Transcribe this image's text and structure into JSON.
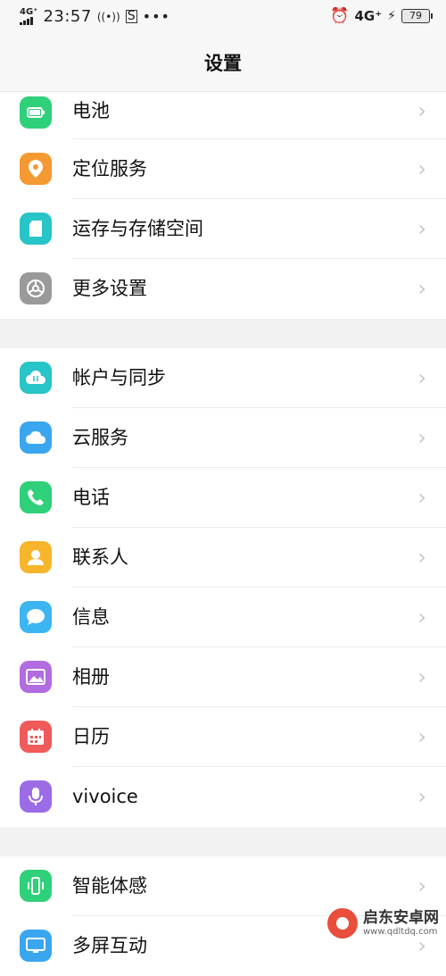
{
  "status_bar": {
    "network_left": "4G⁺",
    "time": "23:57",
    "network_right": "4G⁺",
    "battery": "79"
  },
  "header": {
    "title": "设置"
  },
  "groups": [
    {
      "items": [
        {
          "label": "电池",
          "icon": "battery-icon",
          "color": "#2fd07a"
        },
        {
          "label": "定位服务",
          "icon": "location-icon",
          "color": "#f59a32"
        },
        {
          "label": "运存与存储空间",
          "icon": "storage-icon",
          "color": "#27c4c8"
        },
        {
          "label": "更多设置",
          "icon": "gear-icon",
          "color": "#9a9a9a"
        }
      ]
    },
    {
      "items": [
        {
          "label": "帐户与同步",
          "icon": "cloud-sync-icon",
          "color": "#27c4c8"
        },
        {
          "label": "云服务",
          "icon": "cloud-icon",
          "color": "#3aa6f0"
        },
        {
          "label": "电话",
          "icon": "phone-icon",
          "color": "#2fd07a"
        },
        {
          "label": "联系人",
          "icon": "contact-icon",
          "color": "#f7b52b"
        },
        {
          "label": "信息",
          "icon": "message-icon",
          "color": "#3bb6f2"
        },
        {
          "label": "相册",
          "icon": "album-icon",
          "color": "#b26be0"
        },
        {
          "label": "日历",
          "icon": "calendar-icon",
          "color": "#f05a5a"
        },
        {
          "label": "vivoice",
          "icon": "microphone-icon",
          "color": "#9b6ce6"
        }
      ]
    },
    {
      "items": [
        {
          "label": "智能体感",
          "icon": "motion-icon",
          "color": "#2fd07a"
        },
        {
          "label": "多屏互动",
          "icon": "multiscreen-icon",
          "color": "#3aa6f0"
        }
      ]
    }
  ],
  "watermark": {
    "name": "启东安卓网",
    "url": "www.qdltdq.com"
  }
}
